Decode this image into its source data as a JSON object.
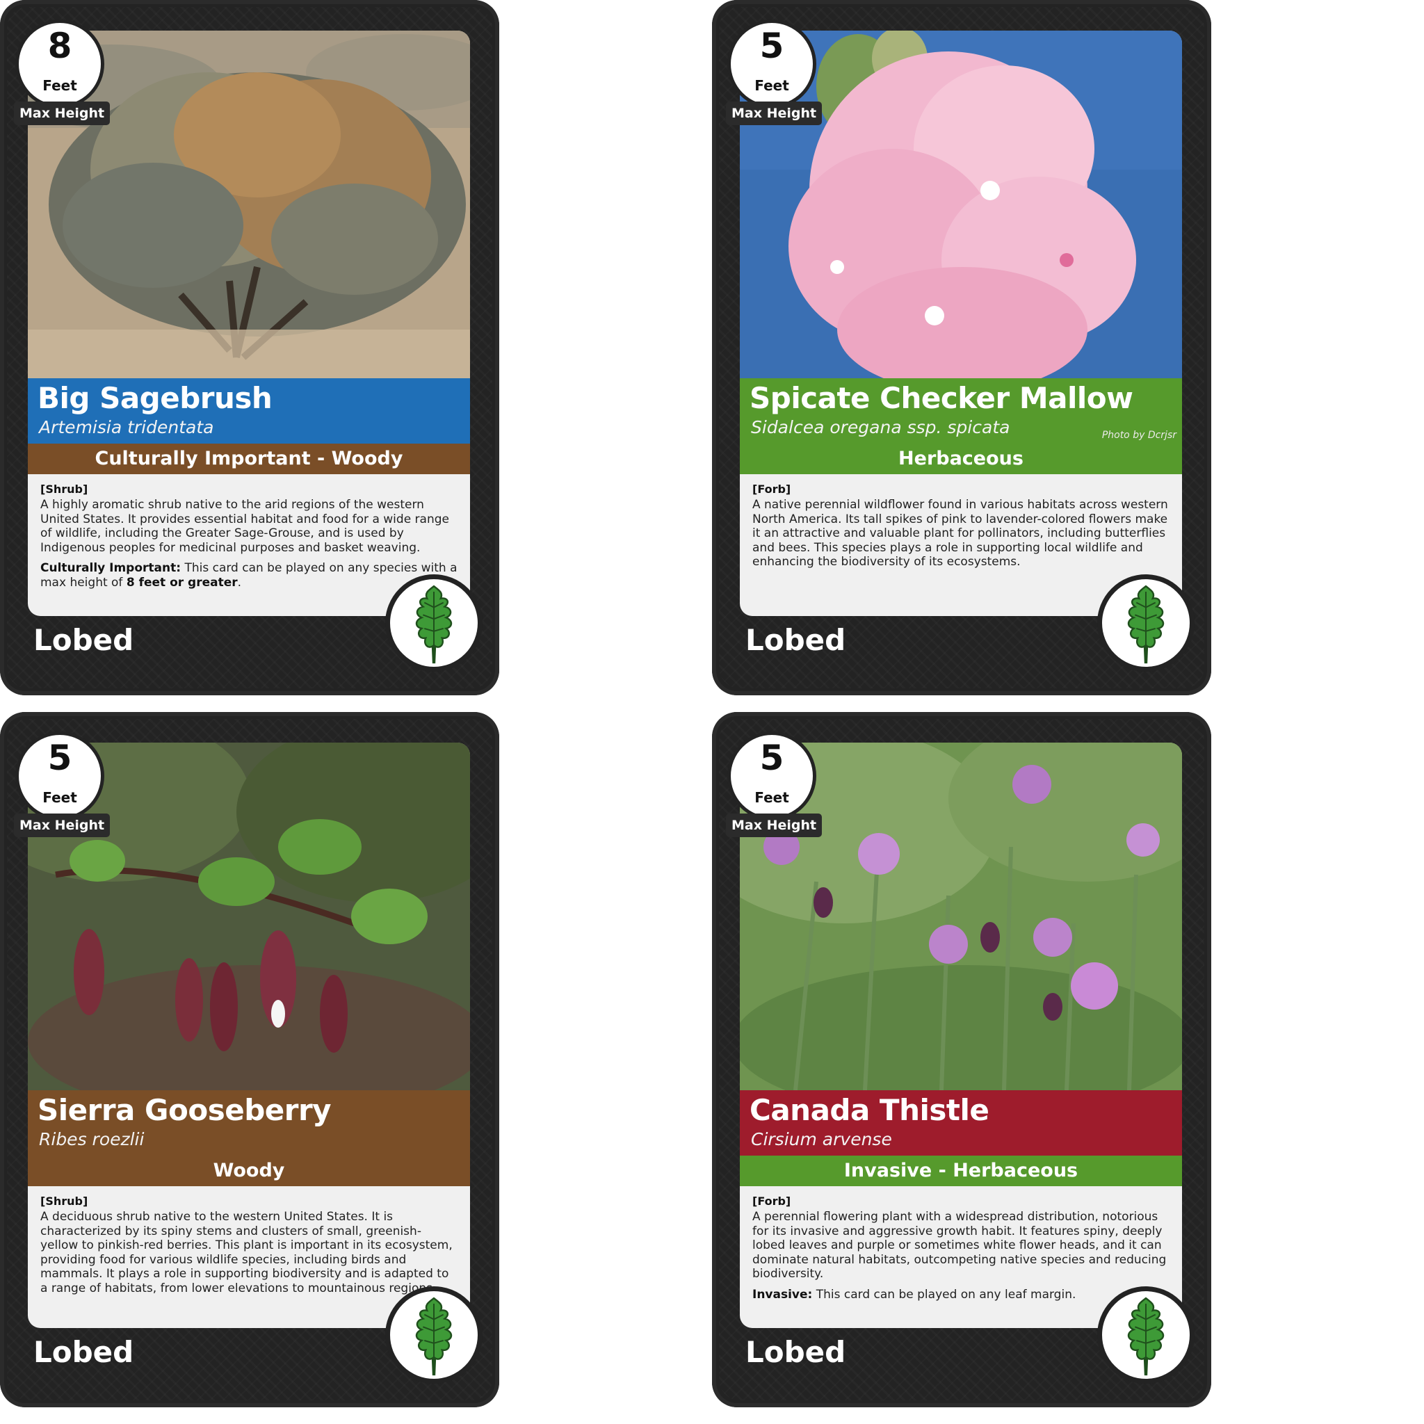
{
  "colors": {
    "card_bg": "#232323",
    "panel_bg": "#f0f0f0",
    "blue_title": "#1f6fb7",
    "green_title": "#569a2c",
    "brown": "#7a4e27",
    "red_title": "#9e1c2c",
    "leaf": "#3e9a37"
  },
  "cards": [
    {
      "height_value": "8",
      "height_unit": "Feet",
      "height_label": "Max Height",
      "common_name": "Big Sagebrush",
      "scientific_name": "Artemisia tridentata",
      "category": "Culturally Important - Woody",
      "plant_type": "[Shrub]",
      "description": "A highly aromatic shrub native to the arid regions of the western United States. It provides essential habitat and food for a wide range of wildlife, including the Greater Sage-Grouse, and is used by Indigenous peoples for medicinal purposes and basket weaving.",
      "rule_label": "Culturally Important:",
      "rule_text": " This card can be played on any species with a max height of ",
      "rule_strong": "8 feet or greater",
      "rule_end": ".",
      "leaf_margin": "Lobed",
      "leaf_icon": "lobed-leaf-icon",
      "title_color": "#1f6fb7",
      "category_color": "#7a4e27",
      "photo_subject": "sagebrush"
    },
    {
      "height_value": "5",
      "height_unit": "Feet",
      "height_label": "Max Height",
      "common_name": "Spicate Checker Mallow",
      "scientific_name": "Sidalcea oregana ssp. spicata",
      "photo_credit": "Photo by Dcrjsr",
      "category": "Herbaceous",
      "plant_type": "[Forb]",
      "description": "A native perennial wildflower found in various habitats across western North America. Its tall spikes of pink to lavender-colored flowers make it an attractive and valuable plant for pollinators, including butterflies and bees. This species plays a role in supporting local wildlife and enhancing the biodiversity of its ecosystems.",
      "leaf_margin": "Lobed",
      "leaf_icon": "lobed-leaf-icon",
      "title_color": "#569a2c",
      "category_color": "#569a2c",
      "photo_subject": "pink-mallow"
    },
    {
      "height_value": "5",
      "height_unit": "Feet",
      "height_label": "Max Height",
      "common_name": "Sierra Gooseberry",
      "scientific_name": "Ribes roezlii",
      "category": "Woody",
      "plant_type": "[Shrub]",
      "description": "A deciduous shrub native to the western United States. It is characterized by its spiny stems and clusters of small, greenish-yellow to pinkish-red berries. This plant is important in its ecosystem, providing food for various wildlife species, including birds and mammals. It plays a role in supporting biodiversity and is adapted to a range of habitats, from lower elevations to mountainous regions.",
      "leaf_margin": "Lobed",
      "leaf_icon": "lobed-leaf-icon",
      "title_color": "#7a4e27",
      "category_color": "#7a4e27",
      "photo_subject": "gooseberry"
    },
    {
      "height_value": "5",
      "height_unit": "Feet",
      "height_label": "Max Height",
      "common_name": "Canada Thistle",
      "scientific_name": "Cirsium arvense",
      "category": "Invasive - Herbaceous",
      "plant_type": "[Forb]",
      "description": "A perennial flowering plant with a widespread distribution, notorious for its invasive and aggressive growth habit. It features spiny, deeply lobed leaves and purple or sometimes white flower heads, and it can dominate natural habitats, outcompeting native species and reducing biodiversity.",
      "rule_label": "Invasive:",
      "rule_text": " This card can be played on any leaf margin.",
      "leaf_margin": "Lobed",
      "leaf_icon": "lobed-leaf-icon",
      "title_color": "#9e1c2c",
      "category_color": "#569a2c",
      "photo_subject": "thistle"
    }
  ]
}
